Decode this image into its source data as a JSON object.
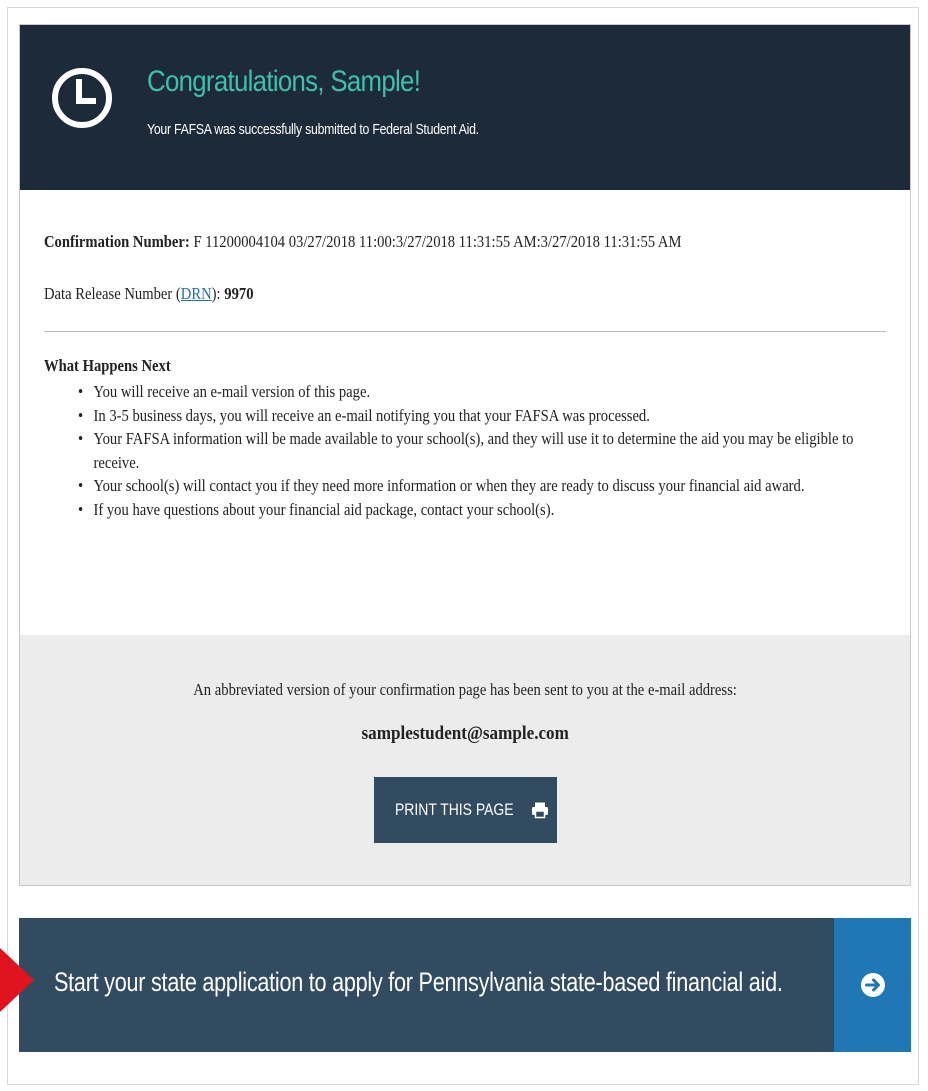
{
  "header": {
    "title": "Congratulations, Sample!",
    "subtitle": "Your FAFSA was successfully submitted to Federal Student Aid.",
    "icon": "clock-icon"
  },
  "confirmation": {
    "label": "Confirmation Number:",
    "value": " F 11200004104 03/27/2018 11:00:3/27/2018 11:31:55 AM:3/27/2018 11:31:55 AM"
  },
  "drn": {
    "prefix": "Data Release Number (",
    "link": "DRN",
    "suffix": "):",
    "value": " 9970"
  },
  "next_steps": {
    "heading": "What Happens Next",
    "items": [
      "You will receive an e-mail version of this page.",
      "In 3-5 business days, you will receive an e-mail notifying you that your FAFSA was processed.",
      "Your FAFSA information will be made available to your school(s), and they will use it to determine the aid you may be eligible to receive.",
      "Your school(s) will contact you if they need more information or when they are ready to discuss your financial aid award.",
      "If you have questions about your financial aid package, contact your school(s)."
    ]
  },
  "email": {
    "note": "An abbreviated version of your confirmation page has been sent to you at the e-mail address:",
    "address": "samplestudent@sample.com"
  },
  "print_button": {
    "label": "PRINT THIS PAGE",
    "icon": "printer-icon"
  },
  "state_banner": {
    "text": "Start your state application to apply for Pennsylvania state-based financial aid.",
    "icon": "arrow-right-circle-icon"
  },
  "colors": {
    "header_bg": "#1c2a39",
    "title": "#3fbfad",
    "button_bg": "#324b61",
    "arrow_box": "#1f78b4",
    "marker": "#e0141e"
  }
}
